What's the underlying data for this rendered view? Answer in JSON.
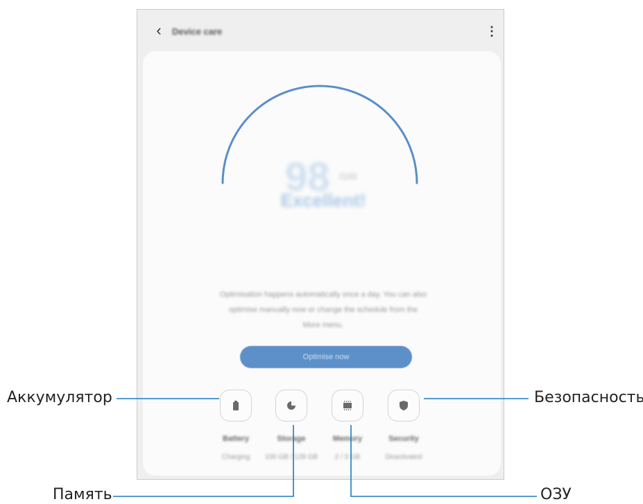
{
  "header": {
    "title": "Device care",
    "back_icon": "‹",
    "more_icon": "⋮"
  },
  "score": {
    "value": "98",
    "unit": "/100",
    "status": "Excellent!"
  },
  "description": "Optimisation happens automatically once a day. You can also optimise manually now or change the schedule from the More menu.",
  "optimize_button": "Optimise now",
  "tiles": [
    {
      "name": "battery",
      "label": "Battery",
      "sub": "Charging",
      "icon": "battery-icon"
    },
    {
      "name": "storage",
      "label": "Storage",
      "sub": "100 GB / 128 GB",
      "icon": "pie-icon"
    },
    {
      "name": "memory",
      "label": "Memory",
      "sub": "2 / 3 GB",
      "icon": "chip-icon"
    },
    {
      "name": "security",
      "label": "Security",
      "sub": "Deactivated",
      "icon": "shield-icon"
    }
  ],
  "callouts": {
    "battery": "Аккумулятор",
    "storage": "Память",
    "memory": "ОЗУ",
    "security": "Безопасность"
  },
  "colors": {
    "accent": "#5d8fc9",
    "callout_line": "#1b7bbd"
  }
}
